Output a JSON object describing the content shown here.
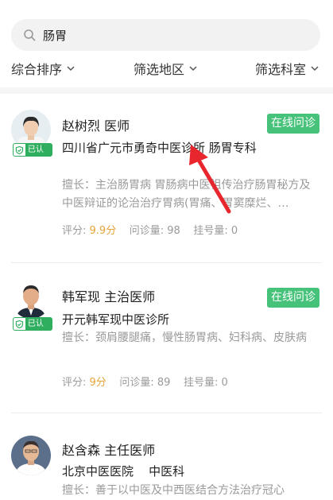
{
  "search": {
    "value": "肠胃",
    "icon": "search-icon"
  },
  "filters": [
    {
      "label": "综合排序"
    },
    {
      "label": "筛选地区"
    },
    {
      "label": "筛选科室"
    }
  ],
  "doctors": [
    {
      "name_title": "赵树烈 医师",
      "institution": "四川省广元市勇奇中医诊所 肠胃专科",
      "specialty": "擅长：主治肠胃病 胃肠病中医祖传治疗肠胃秘方及中医辩证的论治治疗胃病(胃痛、胃窦糜烂、…",
      "rating_label": "评分:",
      "rating": "9.9分",
      "consult_label": "问诊量:",
      "consult": "98",
      "register_label": "挂号量:",
      "register": "0",
      "badge": "已认证",
      "action": "在线问诊"
    },
    {
      "name_title": "韩军现 主治医师",
      "institution": "开元韩军现中医诊所",
      "specialty": "擅长：颈肩腰腿痛，慢性肠胃病、妇科病、皮肤病",
      "rating_label": "评分:",
      "rating": "9分",
      "consult_label": "问诊量:",
      "consult": "89",
      "register_label": "挂号量:",
      "register": "0",
      "badge": "已认证",
      "action": "在线问诊"
    },
    {
      "name_title": "赵含森 主任医师",
      "institution": "北京中医医院    中医科",
      "specialty": "擅长：善于以中医及中西医结合方法治疗冠心"
    }
  ],
  "colors": {
    "accent": "#47c27a",
    "badge": "#2fae5f",
    "rating": "#e8a33a",
    "annotation_arrow": "#e8262d"
  }
}
